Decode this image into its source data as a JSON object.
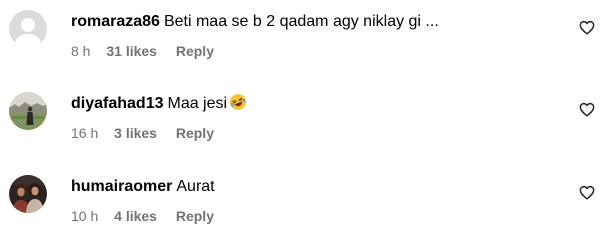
{
  "comments": [
    {
      "username": "romaraza86",
      "text": "Beti maa se b 2 qadam agy niklay gi ...",
      "emoji": "",
      "time": "8 h",
      "likes": "31 likes",
      "reply": "Reply",
      "avatar": "default-avatar-icon"
    },
    {
      "username": "diyafahad13",
      "text": "Maa jesi",
      "emoji": "rolling-on-floor-laughing-emoji",
      "time": "16 h",
      "likes": "3 likes",
      "reply": "Reply",
      "avatar": "profile-photo-outdoor"
    },
    {
      "username": "humairaomer",
      "text": "Aurat",
      "emoji": "",
      "time": "10 h",
      "likes": "4 likes",
      "reply": "Reply",
      "avatar": "profile-photo-dark"
    }
  ],
  "colors": {
    "text_primary": "#000000",
    "text_secondary": "#737373",
    "heart_outline": "#262626",
    "default_avatar_bg": "#dbdbdb",
    "default_avatar_fg": "#ffffff"
  }
}
